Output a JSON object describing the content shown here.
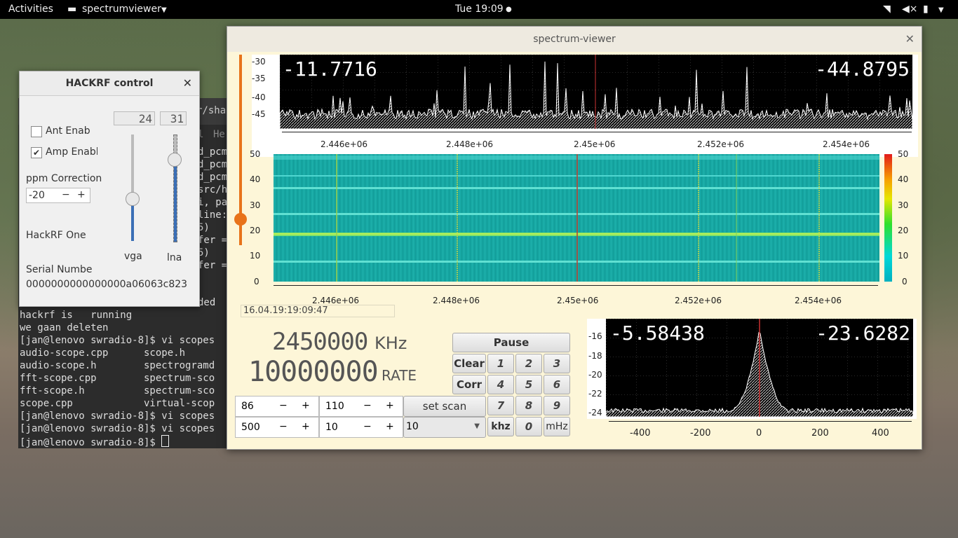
{
  "topbar": {
    "activities": "Activities",
    "app_menu": "spectrumviewer",
    "clock": "Tue 19:09"
  },
  "terminal": {
    "partial_header": "r/shar",
    "partial_tab": "l",
    "partial_tab2": "He",
    "partial_lines": [
      "d_pcm",
      "d_pcm",
      "d_pcm",
      "src/h",
      "i, pa",
      "line:",
      "5)",
      "fer =",
      "5)",
      "fer =",
      "ded"
    ],
    "lines": [
      "hackrf is   running",
      "we gaan deleten",
      "[jan@lenovo swradio-8]$ vi scopes",
      "audio-scope.cpp      scope.h",
      "audio-scope.h        spectrogramd",
      "fft-scope.cpp        spectrum-sco",
      "fft-scope.h          spectrum-sco",
      "scope.cpp            virtual-scop",
      "[jan@lenovo swradio-8]$ vi scopes",
      "[jan@lenovo swradio-8]$ vi scopes",
      "[jan@lenovo swradio-8]$ "
    ]
  },
  "hackrf": {
    "title": "HACKRF control",
    "vga_lcd": "24",
    "lna_lcd": "31",
    "ant_enable": "Ant Enabl",
    "amp_enable": "Amp Enabl",
    "ant_checked": false,
    "amp_checked": true,
    "ppm_label": "ppm Correction",
    "ppm_value": "-20",
    "minus": "−",
    "plus": "+",
    "device": "HackRF One",
    "vga_label": "vga",
    "lna_label": "lna",
    "serial_label": "Serial Numbe",
    "serial_value": "0000000000000000a06063c823"
  },
  "main": {
    "title": "spectrum-viewer",
    "top_plot": {
      "left_value": "-11.7716",
      "right_value": "-44.8795",
      "y_ticks": [
        "-30",
        "-35",
        "-40",
        "-45"
      ],
      "x_ticks": [
        "2.446e+06",
        "2.448e+06",
        "2.45e+06",
        "2.452e+06",
        "2.454e+06"
      ]
    },
    "waterfall": {
      "y_ticks": [
        "50",
        "40",
        "30",
        "20",
        "10",
        "0"
      ],
      "x_ticks": [
        "2.446e+06",
        "2.448e+06",
        "2.45e+06",
        "2.452e+06",
        "2.454e+06"
      ],
      "scale_ticks": [
        "50",
        "40",
        "30",
        "20",
        "10",
        "0"
      ]
    },
    "timestamp": "16.04.19:19:09:47",
    "frequency": "2450000",
    "freq_unit": "KHz",
    "rate": "10000000",
    "rate_label": "RATE",
    "buttons": {
      "pause": "Pause",
      "clear": "Clear",
      "corr": "Corr",
      "set_scan": "set scan",
      "khz": "khz",
      "mhz": "mHz",
      "n1": "1",
      "n2": "2",
      "n3": "3",
      "n4": "4",
      "n5": "5",
      "n6": "6",
      "n7": "7",
      "n8": "8",
      "n9": "9",
      "n0": "0"
    },
    "spin1": "86",
    "spin2": "110",
    "spin3": "500",
    "spin4": "10",
    "combo": "10",
    "minus": "−",
    "plus": "+",
    "bottom_plot": {
      "left_value": "-5.58438",
      "right_value": "-23.6282",
      "y_ticks": [
        "-16",
        "-18",
        "-20",
        "-22",
        "-24"
      ],
      "x_ticks": [
        "-400",
        "-200",
        "0",
        "200",
        "400"
      ]
    }
  }
}
